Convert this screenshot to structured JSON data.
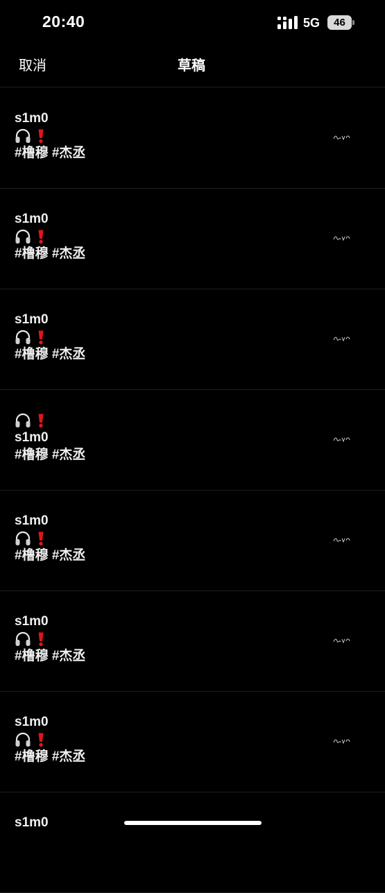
{
  "status": {
    "time": "20:40",
    "network": "5G",
    "battery": "46"
  },
  "nav": {
    "cancel_label": "取消",
    "title": "草稿"
  },
  "drafts": [
    {
      "username": "s1m0",
      "hashtags": "#橹穆 #杰丞"
    },
    {
      "username": "s1m0",
      "hashtags": "#橹穆 #杰丞"
    },
    {
      "username": "s1m0",
      "hashtags": "#橹穆 #杰丞"
    },
    {
      "username": "s1m0",
      "hashtags": "#橹穆 #杰丞"
    },
    {
      "username": "s1m0",
      "hashtags": "#橹穆 #杰丞"
    },
    {
      "username": "s1m0",
      "hashtags": "#橹穆 #杰丞"
    },
    {
      "username": "s1m0",
      "hashtags": "#橹穆 #杰丞"
    },
    {
      "username": "s1m0"
    }
  ]
}
